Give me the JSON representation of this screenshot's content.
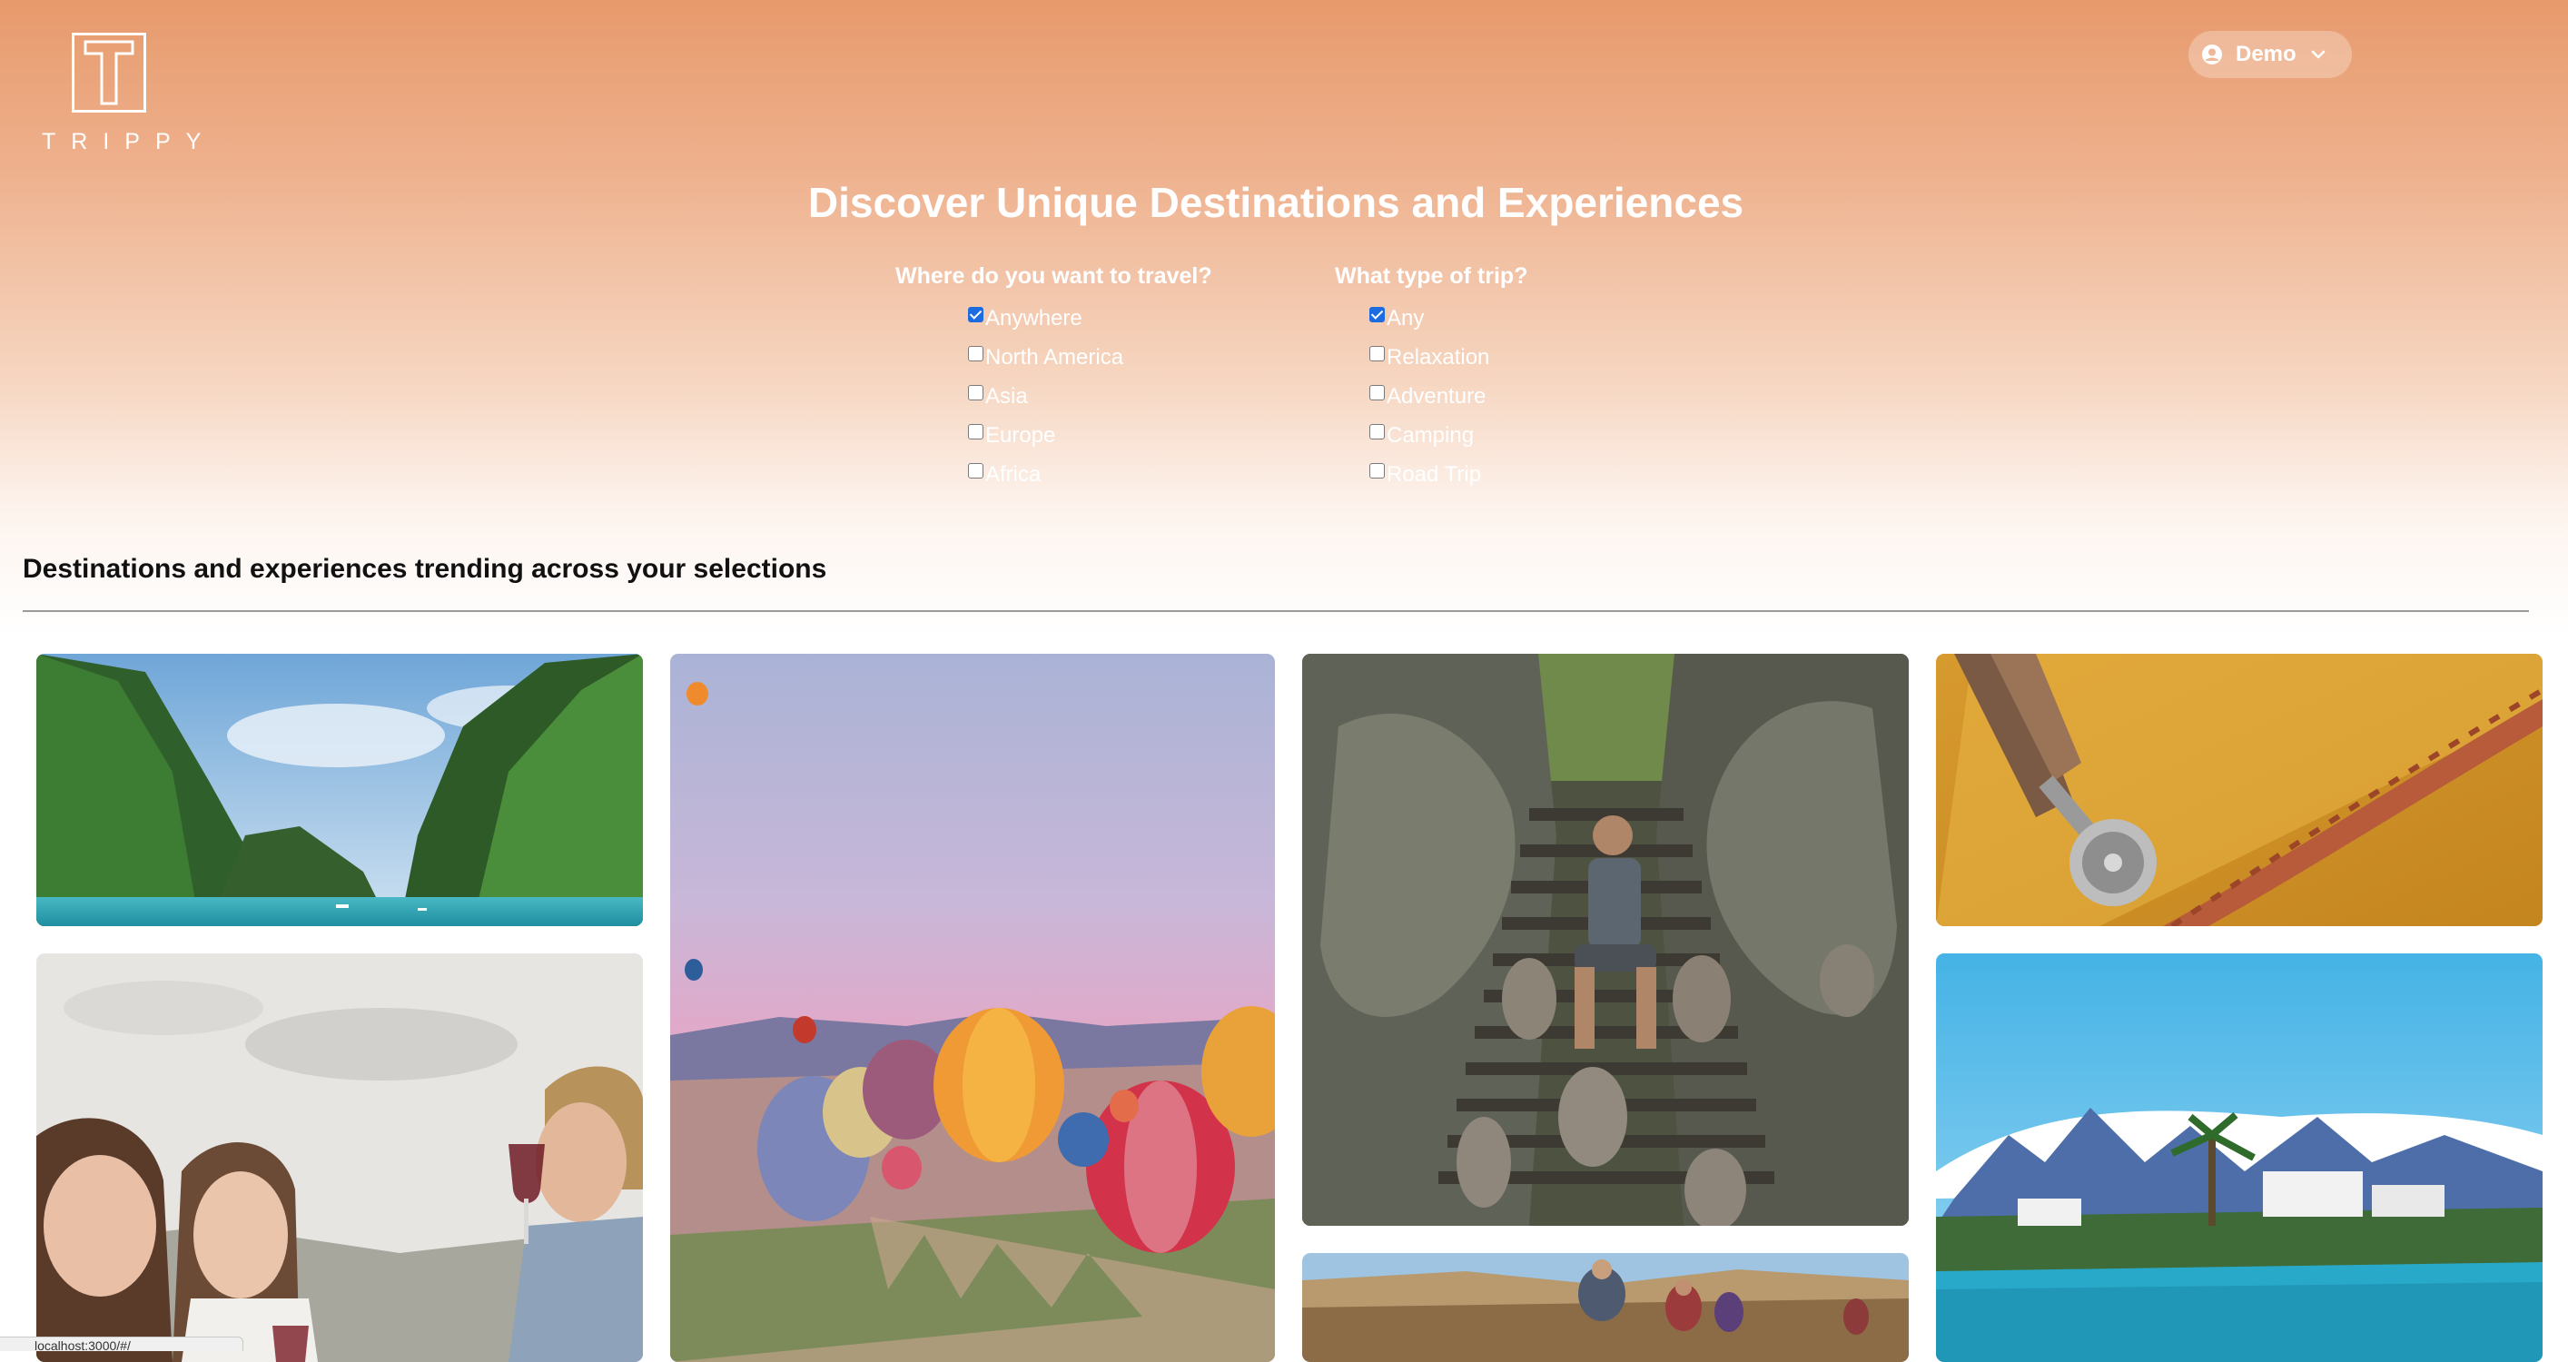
{
  "brand": {
    "logo_letter": "T",
    "name": "TRIPPY"
  },
  "user_menu": {
    "name": "Demo",
    "icon": "user-circle-icon",
    "caret": "chevron-down-icon"
  },
  "hero": {
    "title": "Discover Unique Destinations and Experiences"
  },
  "filters": {
    "destination": {
      "title": "Where do you want to travel?",
      "options": [
        {
          "label": "Anywhere",
          "checked": true
        },
        {
          "label": "North America",
          "checked": false
        },
        {
          "label": "Asia",
          "checked": false
        },
        {
          "label": "Europe",
          "checked": false
        },
        {
          "label": "Africa",
          "checked": false
        }
      ]
    },
    "trip_type": {
      "title": "What type of trip?",
      "options": [
        {
          "label": "Any",
          "checked": true
        },
        {
          "label": "Relaxation",
          "checked": false
        },
        {
          "label": "Adventure",
          "checked": false
        },
        {
          "label": "Camping",
          "checked": false
        },
        {
          "label": "Road Trip",
          "checked": false
        }
      ]
    }
  },
  "trending": {
    "title": "Destinations and experiences trending across your selections",
    "cards": [
      {
        "subject": "tropical limestone cliffs bay"
      },
      {
        "subject": "hot air balloons over valley"
      },
      {
        "subject": "man with monkeys on temple stairs"
      },
      {
        "subject": "pastry cutter on dough"
      },
      {
        "subject": "friends tasting red wine"
      },
      {
        "subject": "coastal town with mountains"
      },
      {
        "subject": "desert camel trek"
      }
    ]
  },
  "status_bar": {
    "url": "localhost:3000/#/"
  },
  "colors": {
    "hero_top": "#e79a6c",
    "hero_bottom": "#ffffff",
    "checkbox_accent": "#1c6be0"
  }
}
